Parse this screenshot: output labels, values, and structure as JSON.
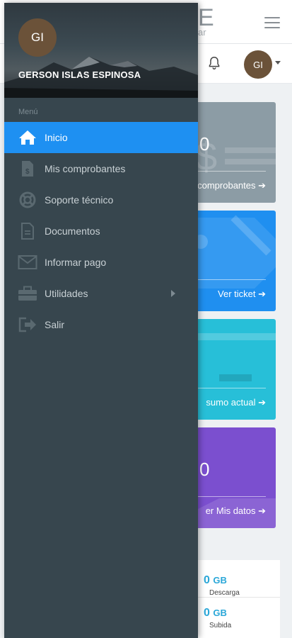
{
  "app": {
    "logo_letter": "E",
    "logo_sub": "ar"
  },
  "header_bar": {
    "avatar_initials": "GI"
  },
  "cards": [
    {
      "value": "0",
      "link": "comprobantes ➔",
      "color": "#8c9ca5"
    },
    {
      "value": "",
      "link": "Ver ticket ➔",
      "color": "#1f8ff0"
    },
    {
      "value": "",
      "link": "sumo actual ➔",
      "color": "#27bfd8"
    },
    {
      "value": "0",
      "link": "er Mis datos ➔",
      "color": "#7b4fcf"
    }
  ],
  "stats": {
    "download": {
      "value": "0",
      "unit": "GB",
      "label": "Descarga"
    },
    "upload": {
      "value": "0",
      "unit": "GB",
      "label": "Subida"
    }
  },
  "drawer": {
    "avatar_initials": "GI",
    "username": "GERSON ISLAS ESPINOSA",
    "menu_title": "Menú",
    "items": [
      {
        "label": "Inicio",
        "icon": "home-icon",
        "active": true
      },
      {
        "label": "Mis comprobantes",
        "icon": "invoice-icon"
      },
      {
        "label": "Soporte técnico",
        "icon": "lifebuoy-icon"
      },
      {
        "label": "Documentos",
        "icon": "document-icon"
      },
      {
        "label": "Informar pago",
        "icon": "envelope-icon"
      },
      {
        "label": "Utilidades",
        "icon": "toolbox-icon",
        "has_submenu": true
      },
      {
        "label": "Salir",
        "icon": "logout-icon"
      }
    ],
    "accent_color": "#1e90f2"
  }
}
